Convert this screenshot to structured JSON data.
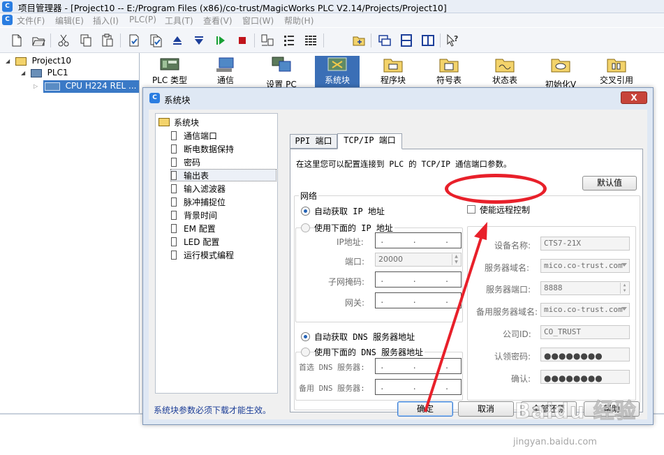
{
  "window": {
    "title": "项目管理器 - [Project10 -- E:/Program Files (x86)/co-trust/MagicWorks PLC V2.14/Projects/Project10]",
    "icon_text": "C"
  },
  "menu": [
    "文件(F)",
    "编辑(E)",
    "插入(I)",
    "PLC(P)",
    "工具(T)",
    "查看(V)",
    "窗口(W)",
    "帮助(H)"
  ],
  "toolbar": {
    "icons": [
      "new-file-icon",
      "open-folder-icon",
      "cut-icon",
      "copy-icon",
      "paste-icon",
      "compile-icon",
      "compile-all-icon",
      "upload-icon",
      "download-icon",
      "run-icon",
      "stop-icon",
      "monitor-icon",
      "program-status-icon",
      "table-status-icon",
      "project-icon",
      "block-icon",
      "split-horizontal-icon",
      "split-vertical-icon",
      "help-pointer-icon"
    ]
  },
  "tree": {
    "project": "Project10",
    "plc": "PLC1",
    "cpu": "CPU H224 REL ..."
  },
  "icon_strip": [
    "PLC 类型",
    "通信",
    "设置 PC",
    "系统块",
    "程序块",
    "符号表",
    "状态表",
    "初始化V",
    "交叉引用"
  ],
  "dialog": {
    "title": "系统块",
    "close": "X",
    "nav": {
      "root": "系统块",
      "items": [
        "通信端口",
        "断电数据保持",
        "密码",
        "输出表",
        "输入滤波器",
        "脉冲捕捉位",
        "背景时间",
        "EM 配置",
        "LED 配置",
        "运行模式编程"
      ],
      "selected_index": 3
    },
    "tabs": [
      "PPI 端口",
      "TCP/IP 端口"
    ],
    "active_tab": 1,
    "description": "在这里您可以配置连接到 PLC 的 TCP/IP 通信端口参数。",
    "default_button": "默认值",
    "network": {
      "legend": "网络",
      "auto_ip": "自动获取 IP 地址",
      "manual_ip": "使用下面的 IP 地址",
      "auto_ip_selected": true,
      "ip_label": "IP地址:",
      "port_label": "端口:",
      "port_value": "20000",
      "subnet_label": "子网掩码:",
      "gateway_label": "网关:",
      "ip_placeholder": ".      .      .",
      "auto_dns": "自动获取 DNS 服务器地址",
      "manual_dns": "使用下面的 DNS 服务器地址",
      "auto_dns_selected": true,
      "dns1_label": "首选 DNS 服务器:",
      "dns2_label": "备用 DNS 服务器:"
    },
    "remote": {
      "enable_label": "使能远程控制",
      "enabled": false,
      "device_name_label": "设备名称:",
      "device_name": "CTS7-21X",
      "server_domain_label": "服务器域名:",
      "server_domain": "mico.co-trust.com",
      "server_port_label": "服务器端口:",
      "server_port": "8888",
      "backup_domain_label": "备用服务器域名:",
      "backup_domain": "mico.co-trust.com",
      "company_id_label": "公司ID:",
      "company_id": "CO_TRUST",
      "password_label": "认领密码:",
      "password_mask": "●●●●●●●●",
      "confirm_label": "确认:",
      "confirm_mask": "●●●●●●●●"
    },
    "footer_note": "系统块参数必须下载才能生效。",
    "buttons": {
      "ok": "确定",
      "cancel": "取消",
      "restore_all": "全部还原",
      "help": "帮助"
    }
  },
  "watermark": {
    "brand": "Baidu 经验",
    "url": "jingyan.baidu.com"
  },
  "colors": {
    "selection": "#3a79c6",
    "annotation_red": "#e8202a",
    "dialog_frame": "#dfe8f4",
    "close_button": "#c7443a",
    "footer_note": "#1a3c96"
  }
}
